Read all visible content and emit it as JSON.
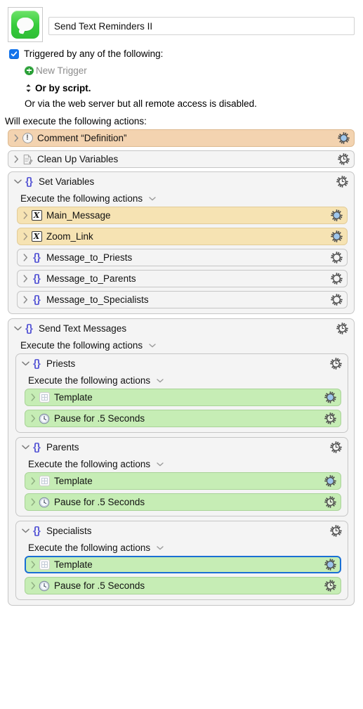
{
  "header": {
    "app_icon": "messages-app-icon",
    "macro_title": "Send Text Reminders II"
  },
  "triggers": {
    "checkbox_checked": true,
    "label": "Triggered by any of the following:",
    "new_trigger": "New Trigger",
    "by_script": "Or by script.",
    "web_server_note": "Or via the web server but all remote access is disabled."
  },
  "will_execute_label": "Will execute the following actions:",
  "actions": [
    {
      "name": "comment-definition",
      "label": "Comment “Definition”",
      "icon": "exclamation-icon",
      "color": "tan",
      "gear": "gear-blue",
      "expanded": false
    },
    {
      "name": "clean-up-variables",
      "label": "Clean Up Variables",
      "icon": "script-document-icon",
      "color": "plain",
      "gear": "gear-clock",
      "expanded": false
    }
  ],
  "set_variables_group": {
    "name": "set-variables",
    "title": "Set Variables",
    "icon": "braces-icon",
    "gear": "gear-clock",
    "exec_label": "Execute the following actions",
    "children": [
      {
        "name": "main-message",
        "label": "Main_Message",
        "icon": "variable-x-icon",
        "color": "yellow",
        "gear": "gear-blue"
      },
      {
        "name": "zoom-link",
        "label": "Zoom_Link",
        "icon": "variable-x-icon",
        "color": "yellow",
        "gear": "gear-blue"
      },
      {
        "name": "message-to-priests",
        "label": "Message_to_Priests",
        "icon": "braces-icon",
        "color": "plain",
        "gear": "gear-plain"
      },
      {
        "name": "message-to-parents",
        "label": "Message_to_Parents",
        "icon": "braces-icon",
        "color": "plain",
        "gear": "gear-plain"
      },
      {
        "name": "message-to-specialists",
        "label": "Message_to_Specialists",
        "icon": "braces-icon",
        "color": "plain",
        "gear": "gear-plain"
      }
    ]
  },
  "send_text_messages_group": {
    "name": "send-text-messages",
    "title": "Send Text Messages",
    "icon": "braces-icon",
    "gear": "gear-clock",
    "exec_label": "Execute the following actions",
    "subgroups": [
      {
        "name": "priests",
        "title": "Priests",
        "icon": "braces-icon",
        "gear": "gear-clock",
        "exec_label": "Execute the following actions",
        "children": [
          {
            "name": "template",
            "label": "Template",
            "icon": "template-grid-icon",
            "color": "green",
            "gear": "gear-blue",
            "selected": false
          },
          {
            "name": "pause",
            "label": "Pause for .5 Seconds",
            "icon": "clock-icon",
            "color": "green",
            "gear": "gear-clock",
            "selected": false
          }
        ]
      },
      {
        "name": "parents",
        "title": "Parents",
        "icon": "braces-icon",
        "gear": "gear-clock",
        "exec_label": "Execute the following actions",
        "children": [
          {
            "name": "template",
            "label": "Template",
            "icon": "template-grid-icon",
            "color": "green",
            "gear": "gear-blue",
            "selected": false
          },
          {
            "name": "pause",
            "label": "Pause for .5 Seconds",
            "icon": "clock-icon",
            "color": "green",
            "gear": "gear-clock",
            "selected": false
          }
        ]
      },
      {
        "name": "specialists",
        "title": "Specialists",
        "icon": "braces-icon",
        "gear": "gear-clock",
        "exec_label": "Execute the following actions",
        "children": [
          {
            "name": "template",
            "label": "Template",
            "icon": "template-grid-icon",
            "color": "green",
            "gear": "gear-blue",
            "selected": true
          },
          {
            "name": "pause",
            "label": "Pause for .5 Seconds",
            "icon": "clock-icon",
            "color": "green",
            "gear": "gear-clock",
            "selected": false
          }
        ]
      }
    ]
  },
  "colors": {
    "accent_blue": "#1273eb",
    "selection_ring": "#1a6fd4",
    "tan_row": "#f3d3b0",
    "yellow_row": "#f6e3b3",
    "green_row": "#c6edb5",
    "braces_purple": "#5b5bd6",
    "trigger_green": "#2aa037"
  }
}
